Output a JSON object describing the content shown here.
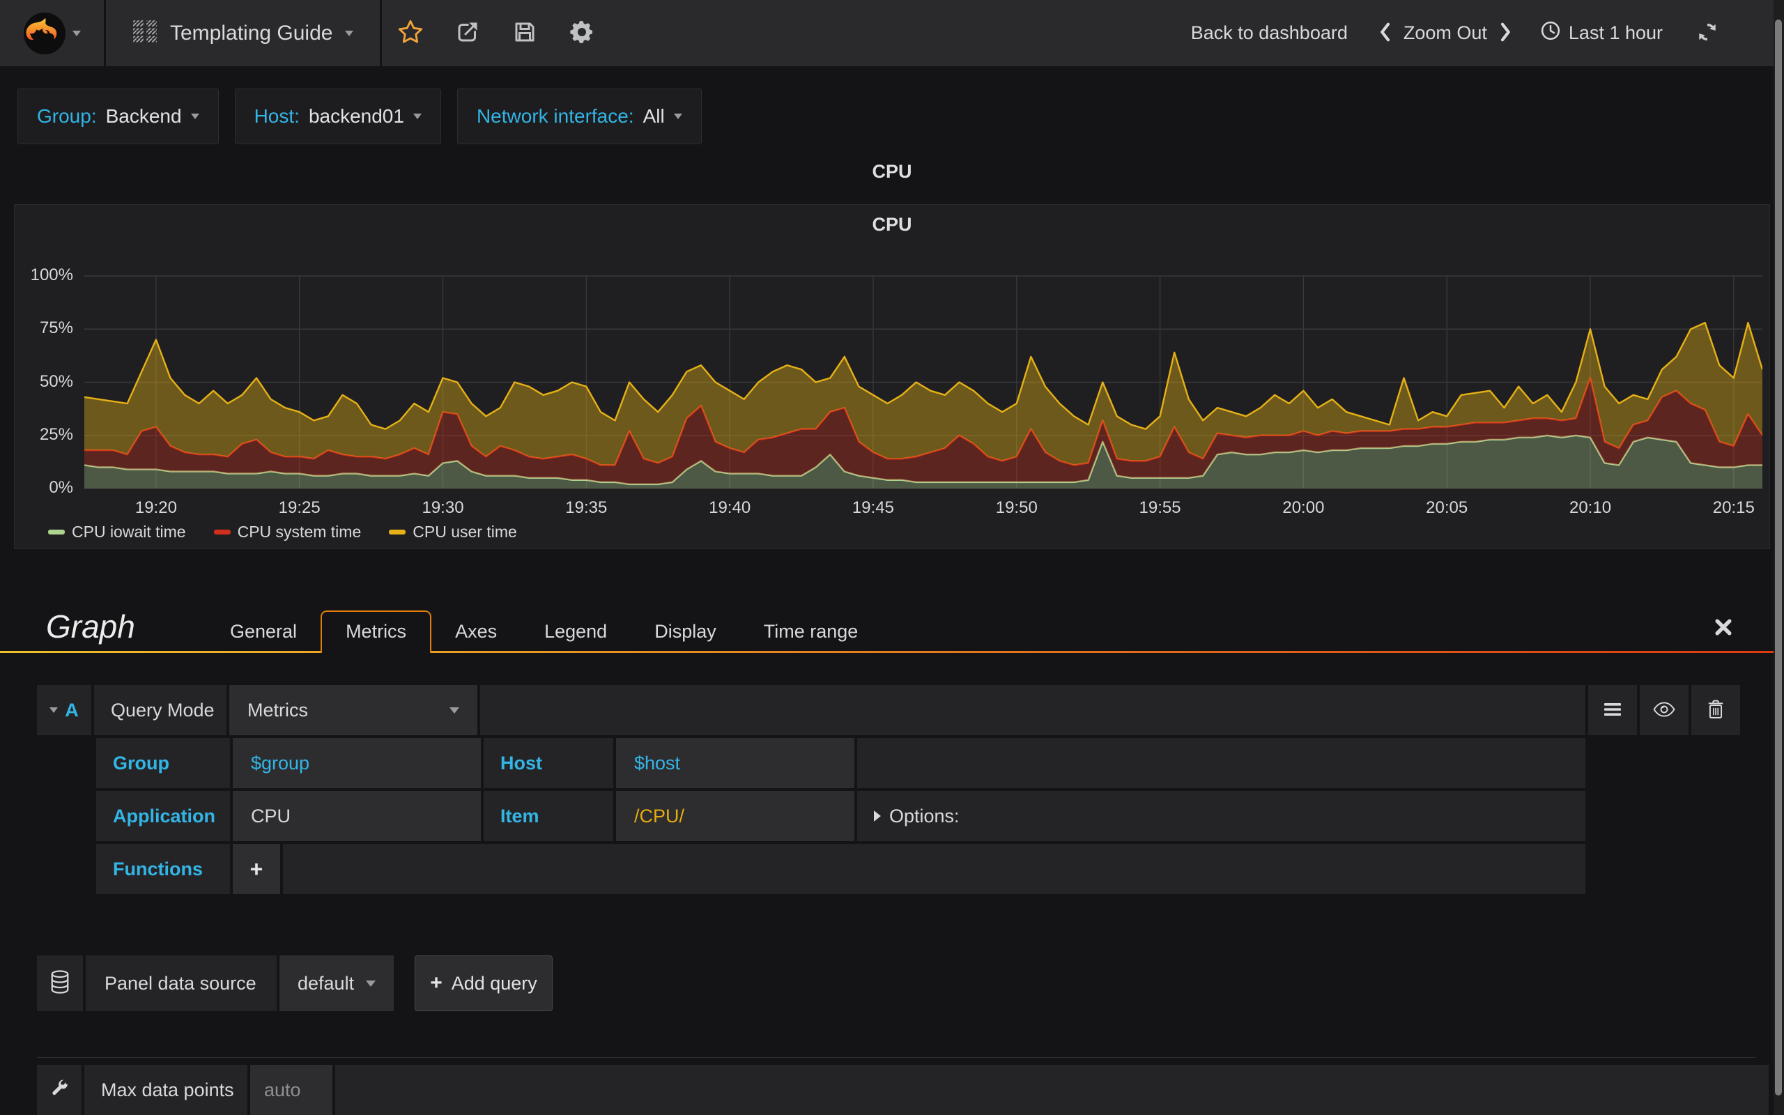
{
  "nav": {
    "dashboard_title": "Templating Guide",
    "back_to_dashboard": "Back to dashboard",
    "zoom_out": "Zoom Out",
    "time_range": "Last 1 hour"
  },
  "icons": {
    "grafana_logo": "grafana-flame",
    "dashboard": "hatched-grid",
    "star": "star-outline",
    "share": "share-arrow",
    "save": "floppy-disk",
    "settings": "gear",
    "clock": "clock",
    "refresh": "circular-arrows",
    "menu": "hamburger",
    "toggle_visibility": "eye",
    "delete": "trash",
    "datasource": "database-cylinder",
    "panel_settings": "wrench",
    "close": "x-cross"
  },
  "variables": {
    "group": {
      "label": "Group:",
      "value": "Backend"
    },
    "host": {
      "label": "Host:",
      "value": "backend01"
    },
    "network": {
      "label": "Network interface:",
      "value": "All"
    }
  },
  "row_title": "CPU",
  "panel": {
    "title": "CPU"
  },
  "chart_data": {
    "type": "area",
    "stacked": true,
    "title": "CPU",
    "xlabel": "",
    "ylabel": "",
    "ylim": [
      0,
      100
    ],
    "grid": true,
    "legend_position": "bottom",
    "y_ticks": [
      "0%",
      "25%",
      "50%",
      "75%",
      "100%"
    ],
    "x_ticks": [
      "19:20",
      "19:25",
      "19:30",
      "19:35",
      "19:40",
      "19:45",
      "19:50",
      "19:55",
      "20:00",
      "20:05",
      "20:10",
      "20:15"
    ],
    "x_tick_indices": [
      5,
      15,
      25,
      35,
      45,
      55,
      65,
      75,
      85,
      95,
      105,
      115
    ],
    "series": [
      {
        "name": "CPU iowait time",
        "color": "#aed28f",
        "fill_opacity": 0.32,
        "values": [
          11,
          10,
          10,
          9,
          9,
          9,
          8,
          8,
          8,
          8,
          7,
          7,
          7,
          8,
          7,
          7,
          6,
          6,
          7,
          7,
          6,
          6,
          6,
          7,
          6,
          12,
          13,
          8,
          6,
          6,
          6,
          5,
          5,
          5,
          4,
          4,
          3,
          3,
          2,
          2,
          2,
          3,
          9,
          13,
          8,
          7,
          7,
          7,
          6,
          6,
          6,
          10,
          16,
          8,
          6,
          5,
          4,
          4,
          3,
          3,
          3,
          3,
          3,
          3,
          3,
          3,
          3,
          3,
          3,
          3,
          4,
          22,
          6,
          5,
          5,
          5,
          5,
          5,
          6,
          16,
          17,
          16,
          16,
          17,
          17,
          18,
          17,
          18,
          18,
          19,
          19,
          19,
          20,
          20,
          21,
          21,
          22,
          22,
          23,
          23,
          24,
          24,
          25,
          24,
          25,
          24,
          12,
          11,
          22,
          24,
          23,
          22,
          12,
          11,
          10,
          10,
          11,
          11
        ]
      },
      {
        "name": "CPU system time",
        "color": "#d2301c",
        "fill_opacity": 0.35,
        "values": [
          7,
          8,
          8,
          7,
          18,
          20,
          12,
          9,
          8,
          8,
          8,
          14,
          16,
          9,
          8,
          8,
          8,
          12,
          9,
          8,
          9,
          8,
          10,
          12,
          10,
          24,
          22,
          12,
          9,
          14,
          12,
          10,
          9,
          10,
          12,
          10,
          8,
          8,
          25,
          12,
          10,
          12,
          24,
          26,
          14,
          12,
          10,
          16,
          18,
          20,
          22,
          18,
          20,
          30,
          16,
          12,
          10,
          10,
          12,
          14,
          16,
          22,
          18,
          12,
          10,
          12,
          25,
          14,
          10,
          8,
          8,
          10,
          8,
          8,
          8,
          10,
          24,
          12,
          8,
          10,
          8,
          8,
          9,
          8,
          8,
          9,
          8,
          9,
          8,
          8,
          8,
          8,
          8,
          8,
          8,
          8,
          8,
          9,
          8,
          8,
          8,
          9,
          8,
          8,
          8,
          28,
          10,
          8,
          8,
          8,
          20,
          24,
          28,
          26,
          12,
          10,
          24,
          14
        ]
      },
      {
        "name": "CPU user time",
        "color": "#e6b117",
        "fill_opacity": 0.4,
        "values": [
          25,
          24,
          23,
          24,
          28,
          41,
          32,
          27,
          24,
          30,
          25,
          23,
          29,
          25,
          23,
          21,
          18,
          16,
          28,
          25,
          15,
          14,
          16,
          21,
          20,
          16,
          15,
          20,
          19,
          18,
          32,
          33,
          30,
          31,
          34,
          34,
          25,
          21,
          23,
          28,
          24,
          29,
          22,
          19,
          28,
          27,
          25,
          27,
          31,
          32,
          28,
          22,
          16,
          24,
          26,
          27,
          26,
          30,
          35,
          29,
          25,
          25,
          25,
          25,
          23,
          25,
          34,
          31,
          27,
          23,
          18,
          18,
          20,
          17,
          15,
          19,
          35,
          25,
          18,
          12,
          11,
          10,
          13,
          19,
          15,
          19,
          13,
          15,
          10,
          7,
          5,
          3,
          24,
          4,
          7,
          5,
          14,
          14,
          15,
          7,
          16,
          7,
          11,
          4,
          17,
          23,
          26,
          21,
          14,
          10,
          13,
          16,
          35,
          41,
          36,
          32,
          43,
          31
        ]
      }
    ]
  },
  "editor": {
    "panel_type": "Graph",
    "tabs": [
      "General",
      "Metrics",
      "Axes",
      "Legend",
      "Display",
      "Time range"
    ],
    "active_tab": "Metrics",
    "query": {
      "letter": "A",
      "query_mode_label": "Query Mode",
      "query_mode_value": "Metrics",
      "group_label": "Group",
      "group_value": "$group",
      "host_label": "Host",
      "host_value": "$host",
      "application_label": "Application",
      "application_value": "CPU",
      "item_label": "Item",
      "item_value": "/CPU/",
      "options_label": "Options:",
      "functions_label": "Functions",
      "add_function_label": "+"
    },
    "datasource": {
      "label": "Panel data source",
      "value": "default",
      "plus": "+",
      "add_query_label": "Add query"
    },
    "max_data_points": {
      "label": "Max data points",
      "placeholder": "auto"
    }
  }
}
